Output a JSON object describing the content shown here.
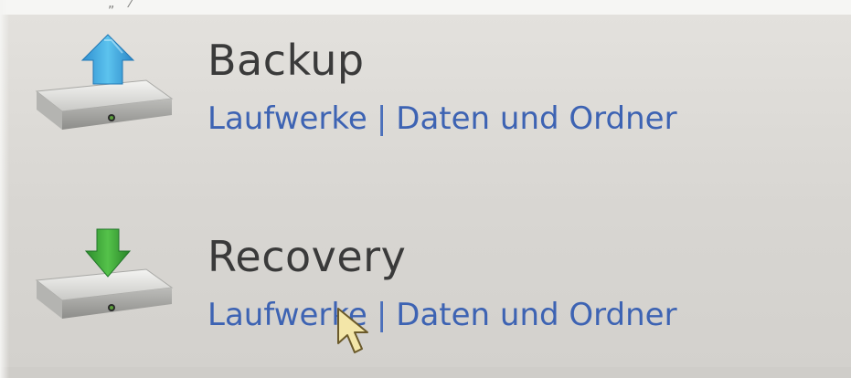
{
  "entries": [
    {
      "title": "Backup",
      "link_drives": "Laufwerke",
      "separator": "|",
      "link_data": "Daten und Ordner",
      "icon": "backup-drive-icon",
      "arrow_color": "#3fa7d8"
    },
    {
      "title": "Recovery",
      "link_drives": "Laufwerke",
      "separator": "|",
      "link_data": "Daten und Ordner",
      "icon": "recovery-drive-icon",
      "arrow_color": "#3aa83a"
    }
  ],
  "colors": {
    "title": "#3a3a3a",
    "link": "#3d63b3",
    "background": "#d9d7d4"
  },
  "cursor": {
    "icon": "arrow-cursor-icon"
  }
}
